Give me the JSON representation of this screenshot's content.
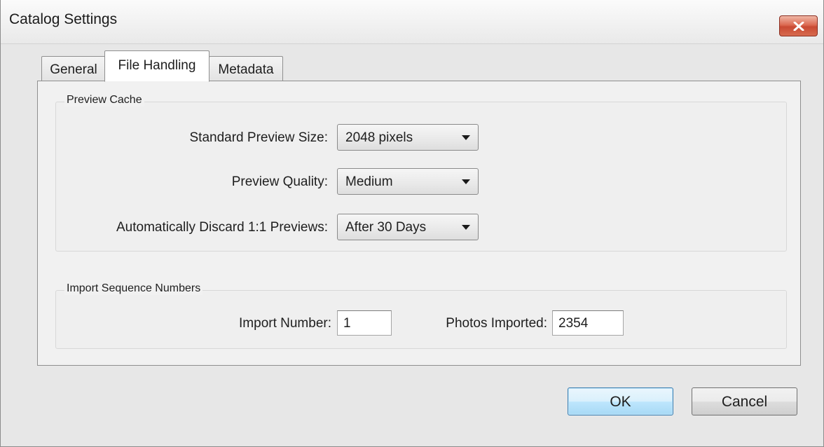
{
  "window": {
    "title": "Catalog Settings"
  },
  "tabs": [
    {
      "label": "General",
      "active": false
    },
    {
      "label": "File Handling",
      "active": true
    },
    {
      "label": "Metadata",
      "active": false
    }
  ],
  "preview_cache": {
    "group_label": "Preview Cache",
    "standard_size": {
      "label": "Standard Preview Size:",
      "value": "2048 pixels"
    },
    "quality": {
      "label": "Preview Quality:",
      "value": "Medium"
    },
    "discard": {
      "label": "Automatically Discard 1:1 Previews:",
      "value": "After 30 Days"
    }
  },
  "import_sequence": {
    "group_label": "Import Sequence Numbers",
    "import_number": {
      "label": "Import Number:",
      "value": "1"
    },
    "photos_imported": {
      "label": "Photos Imported:",
      "value": "2354"
    }
  },
  "buttons": {
    "ok": "OK",
    "cancel": "Cancel"
  },
  "icons": {
    "close": "close-x-icon",
    "dropdown": "chevron-down-icon"
  },
  "colors": {
    "close_button": "#c94a33",
    "default_button_border": "#3c7fb1"
  }
}
